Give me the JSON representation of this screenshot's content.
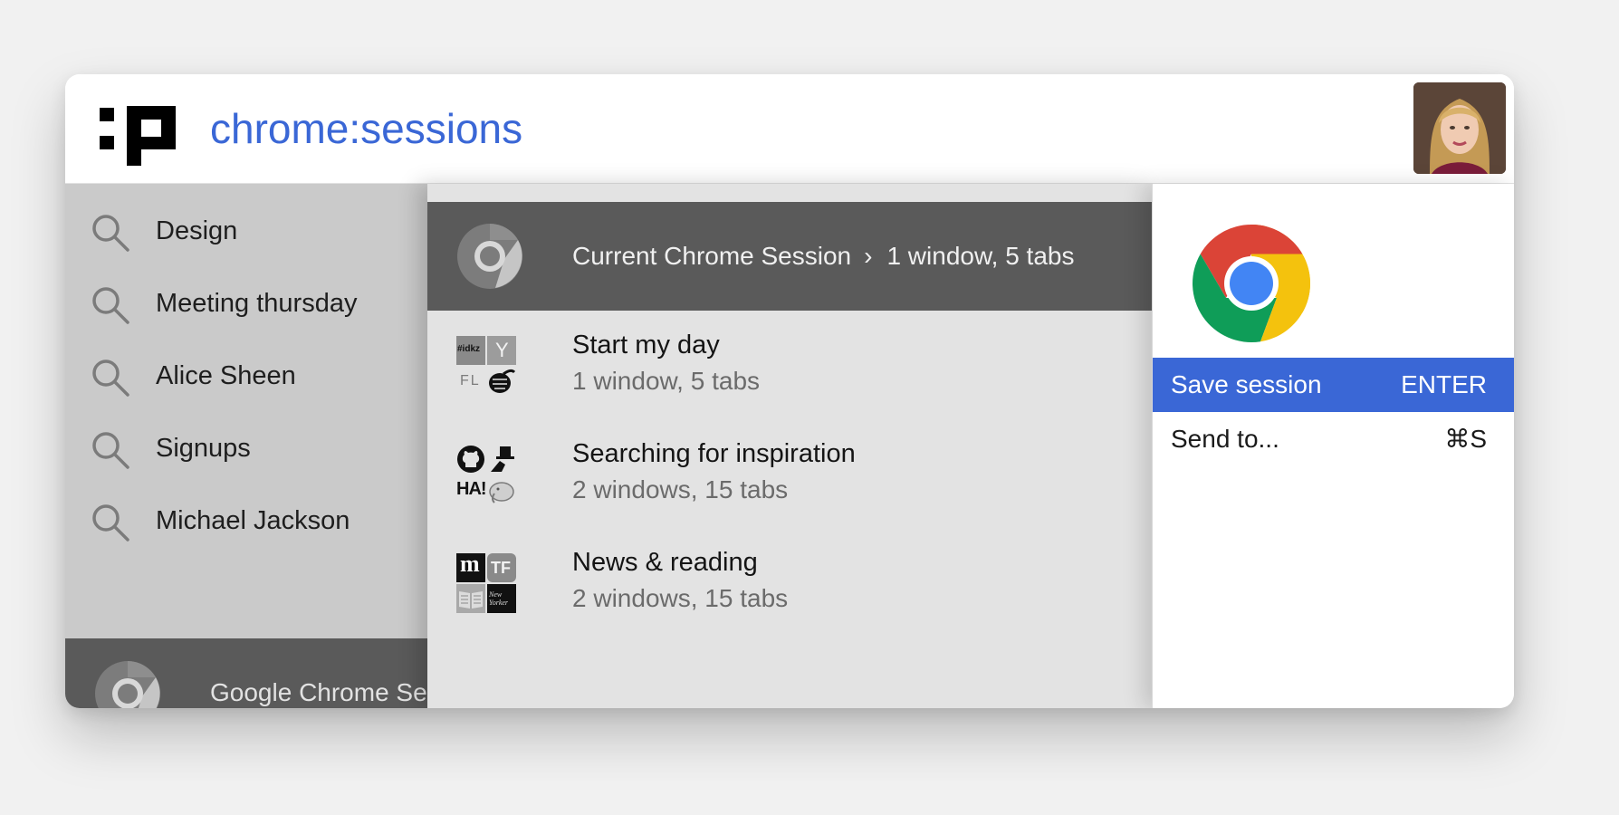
{
  "header": {
    "query": "chrome:sessions"
  },
  "suggestions": [
    {
      "label": "Design",
      "icon": "search-icon"
    },
    {
      "label": "Meeting thursday",
      "icon": "search-icon"
    },
    {
      "label": "Alice Sheen",
      "icon": "search-icon"
    },
    {
      "label": "Signups",
      "icon": "search-icon"
    },
    {
      "label": "Michael Jackson",
      "icon": "search-icon"
    }
  ],
  "left_session": {
    "label": "Google Chrome Se",
    "icon": "chrome-gray-icon"
  },
  "current_session": {
    "title": "Current Chrome Session",
    "separator": "›",
    "meta": "1 window, 5 tabs",
    "icon": "chrome-gray-icon"
  },
  "sessions": [
    {
      "title": "Start my day",
      "meta": "1 window, 5 tabs",
      "favicons": [
        "idkz-icon",
        "y-icon",
        "fl-icon",
        "hop-icon"
      ]
    },
    {
      "title": "Searching for inspiration",
      "meta": "2 windows, 15 tabs",
      "favicons": [
        "github-icon",
        "tophat-icon",
        "ha-icon",
        "elephant-icon"
      ]
    },
    {
      "title": "News & reading",
      "meta": "2 windows, 15 tabs",
      "favicons": [
        "m-icon",
        "tf-icon",
        "book-icon",
        "newyorker-icon"
      ]
    }
  ],
  "favicon_text": {
    "idkz": "#idkz",
    "y": "Y",
    "fl": "FL",
    "ha": "HA!",
    "m": "m",
    "tf": "TF",
    "newyorker": "New Yorker"
  },
  "actions": [
    {
      "label": "Save session",
      "key": "ENTER",
      "selected": true
    },
    {
      "label": "Send to...",
      "key": "⌘S",
      "selected": false
    }
  ],
  "colors": {
    "accent": "#3a67d6",
    "selected_row": "#5a5a5a",
    "left_bg": "#cacaca",
    "mid_bg": "#e3e3e3"
  }
}
